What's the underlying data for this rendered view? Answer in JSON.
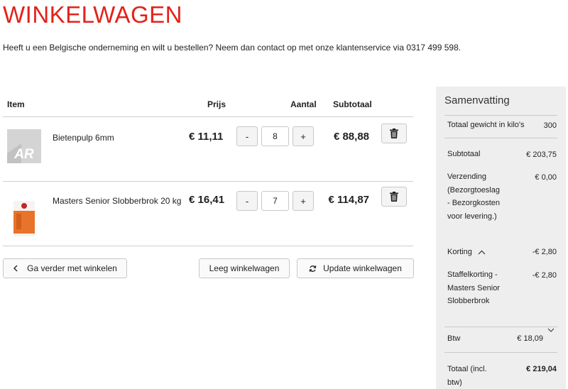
{
  "page": {
    "title": "WINKELWAGEN",
    "intro": "Heeft u een Belgische onderneming en wilt u bestellen? Neem dan contact op met onze klantenservice via 0317 499 598."
  },
  "cart": {
    "headers": {
      "item": "Item",
      "price": "Prijs",
      "qty": "Aantal",
      "subtotal": "Subtotaal"
    },
    "items": [
      {
        "name": "Bietenpulp 6mm",
        "price": "€ 11,11",
        "qty": "8",
        "subtotal": "€ 88,88",
        "minus": "-",
        "plus": "+",
        "thumb_text": "AR"
      },
      {
        "name": "Masters Senior Slobberbrok 20 kg",
        "price": "€ 16,41",
        "qty": "7",
        "subtotal": "€ 114,87",
        "minus": "-",
        "plus": "+"
      }
    ],
    "buttons": {
      "continue": "Ga verder met winkelen",
      "empty": "Leeg winkelwagen",
      "update": "Update winkelwagen"
    }
  },
  "summary": {
    "title": "Samenvatting",
    "weight_label": "Totaal gewicht in kilo's",
    "weight_value": "300",
    "subtotal_label": "Subtotaal",
    "subtotal_value": "€ 203,75",
    "shipping_label": "Verzending (Bezorgtoeslag - Bezorgkosten voor levering.)",
    "shipping_value": "€ 0,00",
    "discount_label": "Korting",
    "discount_value": "-€ 2,80",
    "tier_label": "Staffelkorting - Masters Senior Slobberbrok",
    "tier_value": "-€ 2,80",
    "vat_label": "Btw",
    "vat_value": "€ 18,09",
    "total_label": "Totaal (incl. btw)",
    "total_value": "€ 219,04"
  },
  "colors": {
    "accent": "#e2231a",
    "summary_bg": "#eeeeee"
  }
}
